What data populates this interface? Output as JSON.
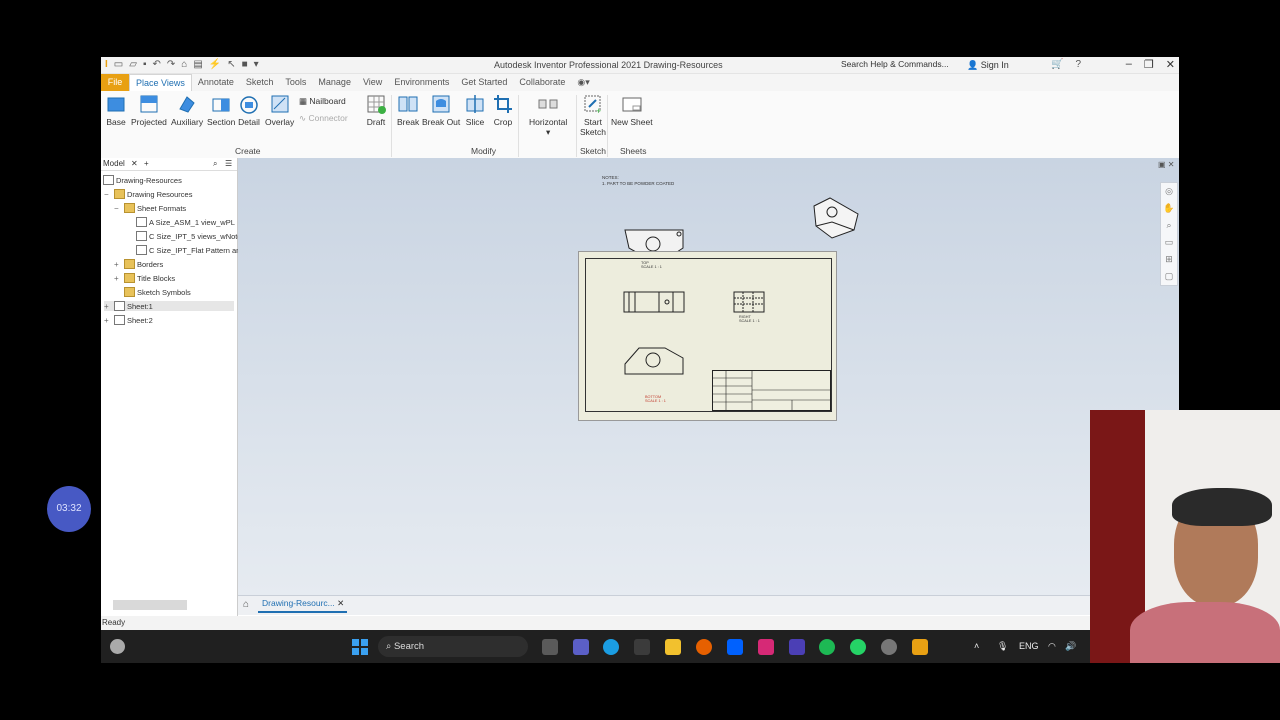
{
  "window": {
    "title": "Autodesk Inventor Professional 2021   Drawing-Resources",
    "search_placeholder": "Search Help & Commands...",
    "sign_in": "Sign In"
  },
  "menu_tabs": [
    "File",
    "Place Views",
    "Annotate",
    "Sketch",
    "Tools",
    "Manage",
    "View",
    "Environments",
    "Get Started",
    "Collaborate"
  ],
  "ribbon": {
    "create": {
      "label": "Create",
      "buttons": [
        "Base",
        "Projected",
        "Auxiliary",
        "Section",
        "Detail",
        "Overlay"
      ],
      "small": [
        "Nailboard",
        "Connector"
      ],
      "draft": "Draft"
    },
    "modify": {
      "label": "Modify",
      "buttons": [
        "Break",
        "Break Out",
        "Slice",
        "Crop",
        "Horizontal"
      ]
    },
    "sketch": {
      "label": "Sketch",
      "button_line1": "Start",
      "button_line2": "Sketch"
    },
    "sheets": {
      "label": "Sheets",
      "button": "New Sheet"
    }
  },
  "browser": {
    "tab": "Model",
    "items": [
      {
        "label": "Drawing-Resources"
      },
      {
        "label": "Drawing Resources"
      },
      {
        "label": "Sheet Formats"
      },
      {
        "label": "A Size_ASM_1 view_wPL"
      },
      {
        "label": "C Size_IPT_5 views_wNote"
      },
      {
        "label": "C Size_IPT_Flat Pattern an"
      },
      {
        "label": "Borders"
      },
      {
        "label": "Title Blocks"
      },
      {
        "label": "Sketch Symbols"
      },
      {
        "label": "Sheet:1"
      },
      {
        "label": "Sheet:2"
      }
    ]
  },
  "drawing": {
    "notes_title": "NOTES:",
    "notes_line": "1.   PART TO BE POWDER COATED",
    "view_top": "TOP",
    "view_right": "RIGHT",
    "view_bottom": "BOTTOM",
    "scale": "SCALE 1 : 1"
  },
  "document_tab": "Drawing-Resourc...",
  "status": "Ready",
  "timer": "03:32",
  "taskbar": {
    "search": "Search",
    "lang": "ENG"
  },
  "colors": {
    "accent": "#1f6fb2",
    "file_tab": "#e8a013",
    "sheet": "#ededdd",
    "taskbar": "#202020"
  }
}
